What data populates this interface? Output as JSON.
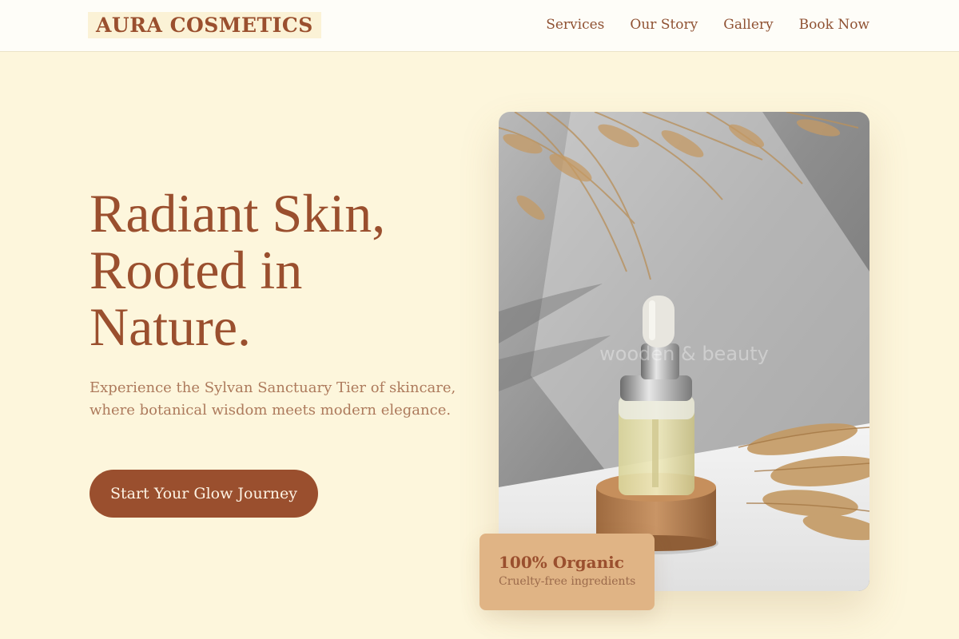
{
  "brand": {
    "name": "AURA COSMETICS"
  },
  "nav": {
    "links": [
      "Services",
      "Our Story",
      "Gallery",
      "Book Now"
    ]
  },
  "hero": {
    "title_lines": [
      "Radiant Skin,",
      "Rooted in",
      "Nature."
    ],
    "subtitle": "Experience the Sylvan Sanctuary Tier of skincare, where botanical wisdom meets modern elegance.",
    "cta_label": "Start Your Glow Journey",
    "image_watermark": "wooden & beauty"
  },
  "badge": {
    "title": "100% Organic",
    "subtitle": "Cruelty-free ingredients"
  },
  "colors": {
    "page_background": "#fdf6dc",
    "nav_background": "#fefdf8",
    "accent": "#9a4f2e",
    "muted_text": "#ad7a5c",
    "badge_background": "#e0b485"
  }
}
